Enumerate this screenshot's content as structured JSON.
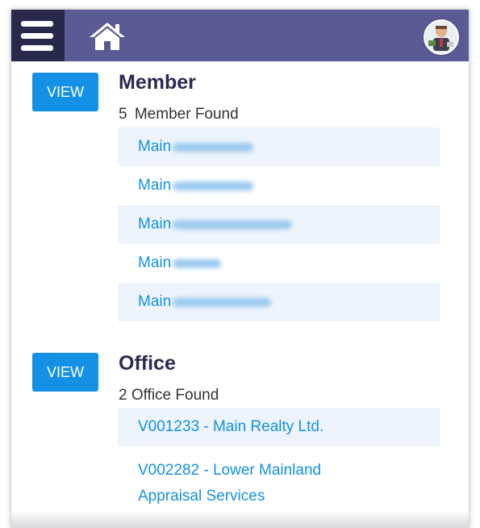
{
  "header": {
    "menu_icon": "hamburger-menu-icon",
    "home_icon": "home-icon",
    "avatar_icon": "user-avatar"
  },
  "member": {
    "view_label": "VIEW",
    "title": "Member",
    "count": "5",
    "count_label": "Member Found",
    "items": [
      {
        "label": "Main"
      },
      {
        "label": "Main"
      },
      {
        "label": "Main"
      },
      {
        "label": "Main"
      },
      {
        "label": "Main"
      }
    ]
  },
  "office": {
    "view_label": "VIEW",
    "title": "Office",
    "count_text": "2 Office Found",
    "items": [
      {
        "label": "V001233 - Main Realty Ltd."
      },
      {
        "label": "V002282 - Lower Mainland Appraisal Services"
      }
    ]
  },
  "colors": {
    "header_bg": "#5a5a94",
    "menu_bg": "#27294a",
    "accent": "#1491e4",
    "title": "#2a2a52",
    "row_shade": "#edf4fb"
  }
}
